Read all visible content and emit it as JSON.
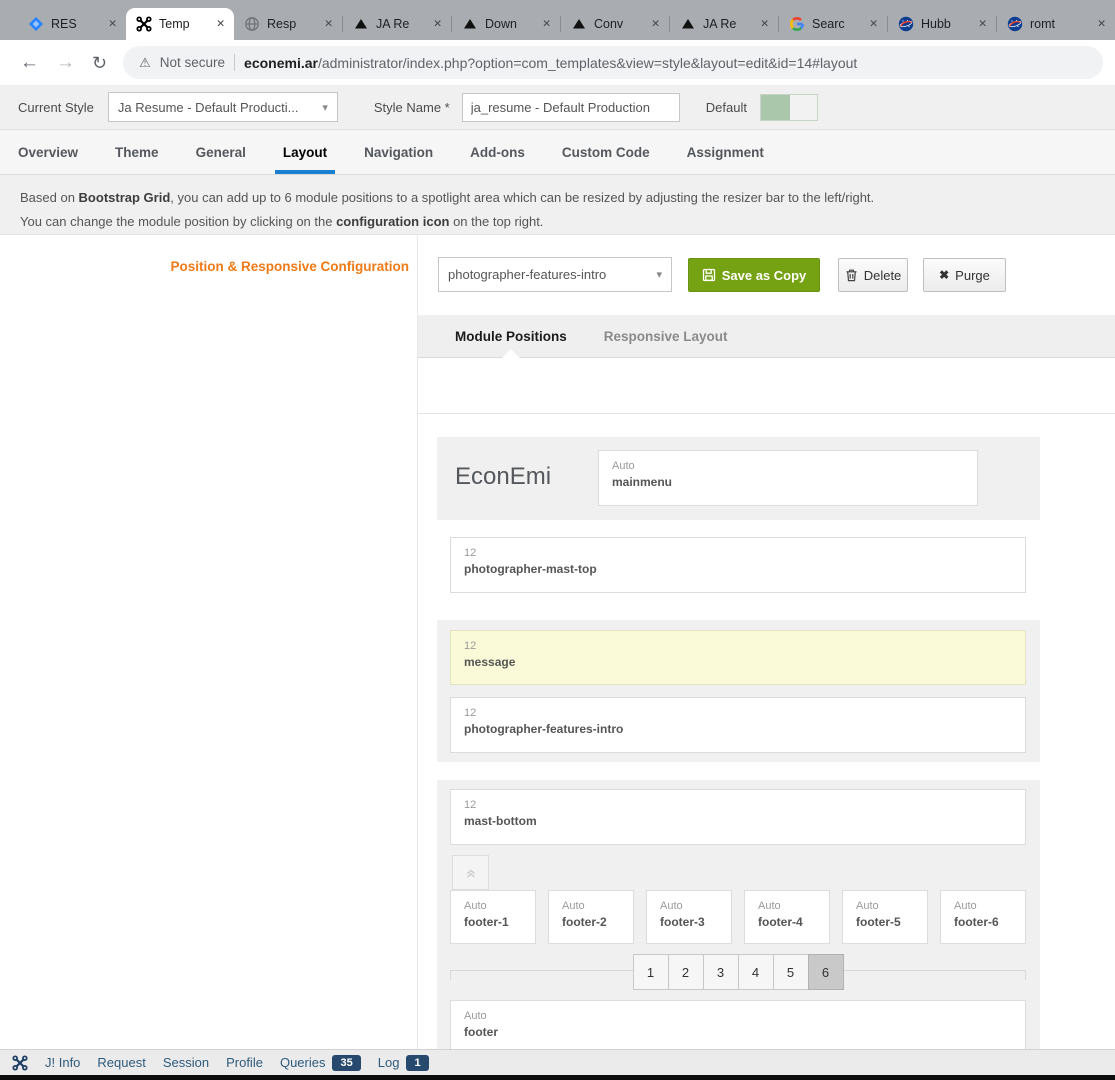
{
  "browser": {
    "close_glyph": "✕",
    "tabs": [
      {
        "label": "RES"
      },
      {
        "label": "Temp"
      },
      {
        "label": "Resp"
      },
      {
        "label": "JA Re"
      },
      {
        "label": "Down"
      },
      {
        "label": "Conv"
      },
      {
        "label": "JA Re"
      },
      {
        "label": "Searc"
      },
      {
        "label": "Hubb"
      },
      {
        "label": "romt"
      }
    ],
    "nav": {
      "back": "←",
      "forward": "→",
      "reload": "↻"
    },
    "address": {
      "warning_glyph": "⚠",
      "security_label": "Not secure",
      "domain": "econemi.ar",
      "path": "/administrator/index.php?option=com_templates&view=style&layout=edit&id=14#layout"
    }
  },
  "style_header": {
    "current_style_label": "Current Style",
    "current_style_value": "Ja Resume - Default Producti...",
    "select_caret": "▾",
    "style_name_label": "Style Name *",
    "style_name_value": "ja_resume - Default Production",
    "default_label": "Default"
  },
  "nav_tabs": [
    "Overview",
    "Theme",
    "General",
    "Layout",
    "Navigation",
    "Add-ons",
    "Custom Code",
    "Assignment"
  ],
  "description": {
    "line1_pre": "Based on ",
    "line1_bold": "Bootstrap Grid",
    "line1_post": ", you can add up to 6 module positions to a spotlight area which can be resized by adjusting the resizer bar to the left/right.",
    "line2_pre": "You can change the module position by clicking on the ",
    "line2_bold": "configuration icon",
    "line2_post": " on the top right."
  },
  "panel": {
    "section_title": "Position & Responsive Configuration",
    "position_select_value": "photographer-features-intro",
    "save_button": "Save as Copy",
    "delete_button": "Delete",
    "purge_button": "Purge",
    "purge_glyph": "✖",
    "subtabs": [
      "Module Positions",
      "Responsive Layout"
    ],
    "preview": {
      "logo": "EconEmi",
      "mainmenu": {
        "size": "Auto",
        "name": "mainmenu"
      },
      "mast_top": {
        "size": "12",
        "name": "photographer-mast-top"
      },
      "message": {
        "size": "12",
        "name": "message"
      },
      "features_intro": {
        "size": "12",
        "name": "photographer-features-intro"
      },
      "mast_bottom": {
        "size": "12",
        "name": "mast-bottom"
      },
      "footer_columns": [
        {
          "size": "Auto",
          "name": "footer-1"
        },
        {
          "size": "Auto",
          "name": "footer-2"
        },
        {
          "size": "Auto",
          "name": "footer-3"
        },
        {
          "size": "Auto",
          "name": "footer-4"
        },
        {
          "size": "Auto",
          "name": "footer-5"
        },
        {
          "size": "Auto",
          "name": "footer-6"
        }
      ],
      "column_selector": {
        "options": [
          "1",
          "2",
          "3",
          "4",
          "5",
          "6"
        ],
        "selected": "6"
      },
      "footer": {
        "size": "Auto",
        "name": "footer"
      }
    }
  },
  "debugbar": {
    "items": [
      "J! Info",
      "Request",
      "Session",
      "Profile"
    ],
    "queries_label": "Queries",
    "queries_count": "35",
    "log_label": "Log",
    "log_count": "1"
  },
  "colors": {
    "tab_active_underline": "#1a80d1",
    "section_title_orange": "#ee7b17",
    "save_green": "#74a212",
    "message_highlight": "#fafad9",
    "badge_navy": "#27496d"
  }
}
